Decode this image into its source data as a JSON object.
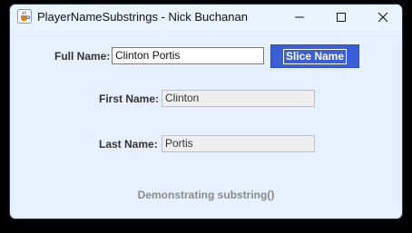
{
  "window": {
    "title": "PlayerNameSubstrings - Nick Buchanan",
    "icon": "java-cup-icon",
    "controls": [
      "minimize-icon",
      "maximize-icon",
      "close-icon"
    ]
  },
  "form": {
    "full_name_label": "Full Name:",
    "full_name_value": "Clinton Portis",
    "slice_button_label": "Slice Name",
    "first_name_label": "First Name:",
    "first_name_value": "Clinton",
    "last_name_label": "Last Name:",
    "last_name_value": "Portis"
  },
  "footer": {
    "text": "Demonstrating substring()"
  },
  "colors": {
    "window_background": "#e6f0ff",
    "button_blue": "#3b5fd6",
    "readonly_field": "#eeeeee",
    "footer_text": "#8a8a8a"
  }
}
